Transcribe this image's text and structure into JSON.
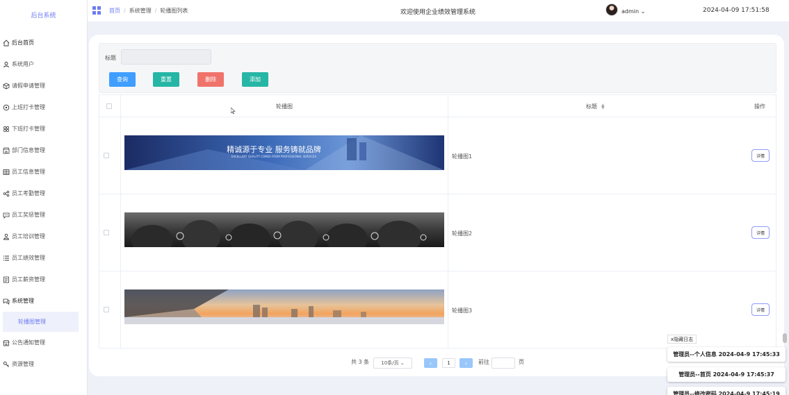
{
  "sidebar": {
    "brand": "后台系统",
    "items": [
      {
        "label": "后台首页",
        "icon": "home-icon"
      },
      {
        "label": "系统用户",
        "icon": "user-icon"
      },
      {
        "label": "请假申请管理",
        "icon": "cube-icon"
      },
      {
        "label": "上班打卡管理",
        "icon": "clock-icon"
      },
      {
        "label": "下班打卡管理",
        "icon": "apps-icon"
      },
      {
        "label": "部门信息管理",
        "icon": "shop-icon"
      },
      {
        "label": "员工信息管理",
        "icon": "table-icon"
      },
      {
        "label": "员工考勤管理",
        "icon": "share-icon"
      },
      {
        "label": "员工奖惩管理",
        "icon": "chat-icon"
      },
      {
        "label": "员工培训管理",
        "icon": "person-icon"
      },
      {
        "label": "员工绩效管理",
        "icon": "list-icon"
      },
      {
        "label": "员工薪资管理",
        "icon": "document-icon"
      },
      {
        "label": "系统管理",
        "icon": "chat-group-icon"
      }
    ],
    "submenu": {
      "label": "轮播图管理"
    },
    "items_after": [
      {
        "label": "公告通知管理",
        "icon": "store-icon"
      },
      {
        "label": "资源管理",
        "icon": "key-icon"
      }
    ]
  },
  "header": {
    "breadcrumb": [
      "首页",
      "系统管理",
      "轮播图列表"
    ],
    "welcome": "欢迎使用企业绩效管理系统",
    "user": "admin",
    "datetime": "2024-04-09 17:51:58"
  },
  "filter": {
    "label": "标题",
    "value": "",
    "buttons": {
      "query": "查询",
      "reset": "重置",
      "delete": "删除",
      "add": "添加"
    }
  },
  "table": {
    "columns": {
      "image": "轮播图",
      "title": "标题",
      "action": "操作"
    },
    "rows": [
      {
        "title": "轮播图1",
        "action": "详情",
        "banner_text": "精诚源于专业 服务铸就品牌",
        "banner_sub": "EXCELLENT QUALITY COMES FROM PROFESSIONAL SERVICES"
      },
      {
        "title": "轮播图2",
        "action": "详情"
      },
      {
        "title": "轮播图3",
        "action": "详情"
      }
    ]
  },
  "pagination": {
    "total": "共 3 条",
    "page_size": "10条/页",
    "current": "1",
    "goto_prefix": "前往",
    "goto_suffix": "页"
  },
  "log": {
    "toggle": "x隐藏日志",
    "entries": [
      "管理员--个人信息 2024-04-9 17:45:33",
      "管理员--首页 2024-04-9 17:45:37",
      "管理员--修改密码 2024-04-9 17:45:19"
    ]
  },
  "colors": {
    "accent": "#6e7bf2",
    "query": "#409eff",
    "teal": "#26b6a5",
    "danger": "#f0736b"
  }
}
